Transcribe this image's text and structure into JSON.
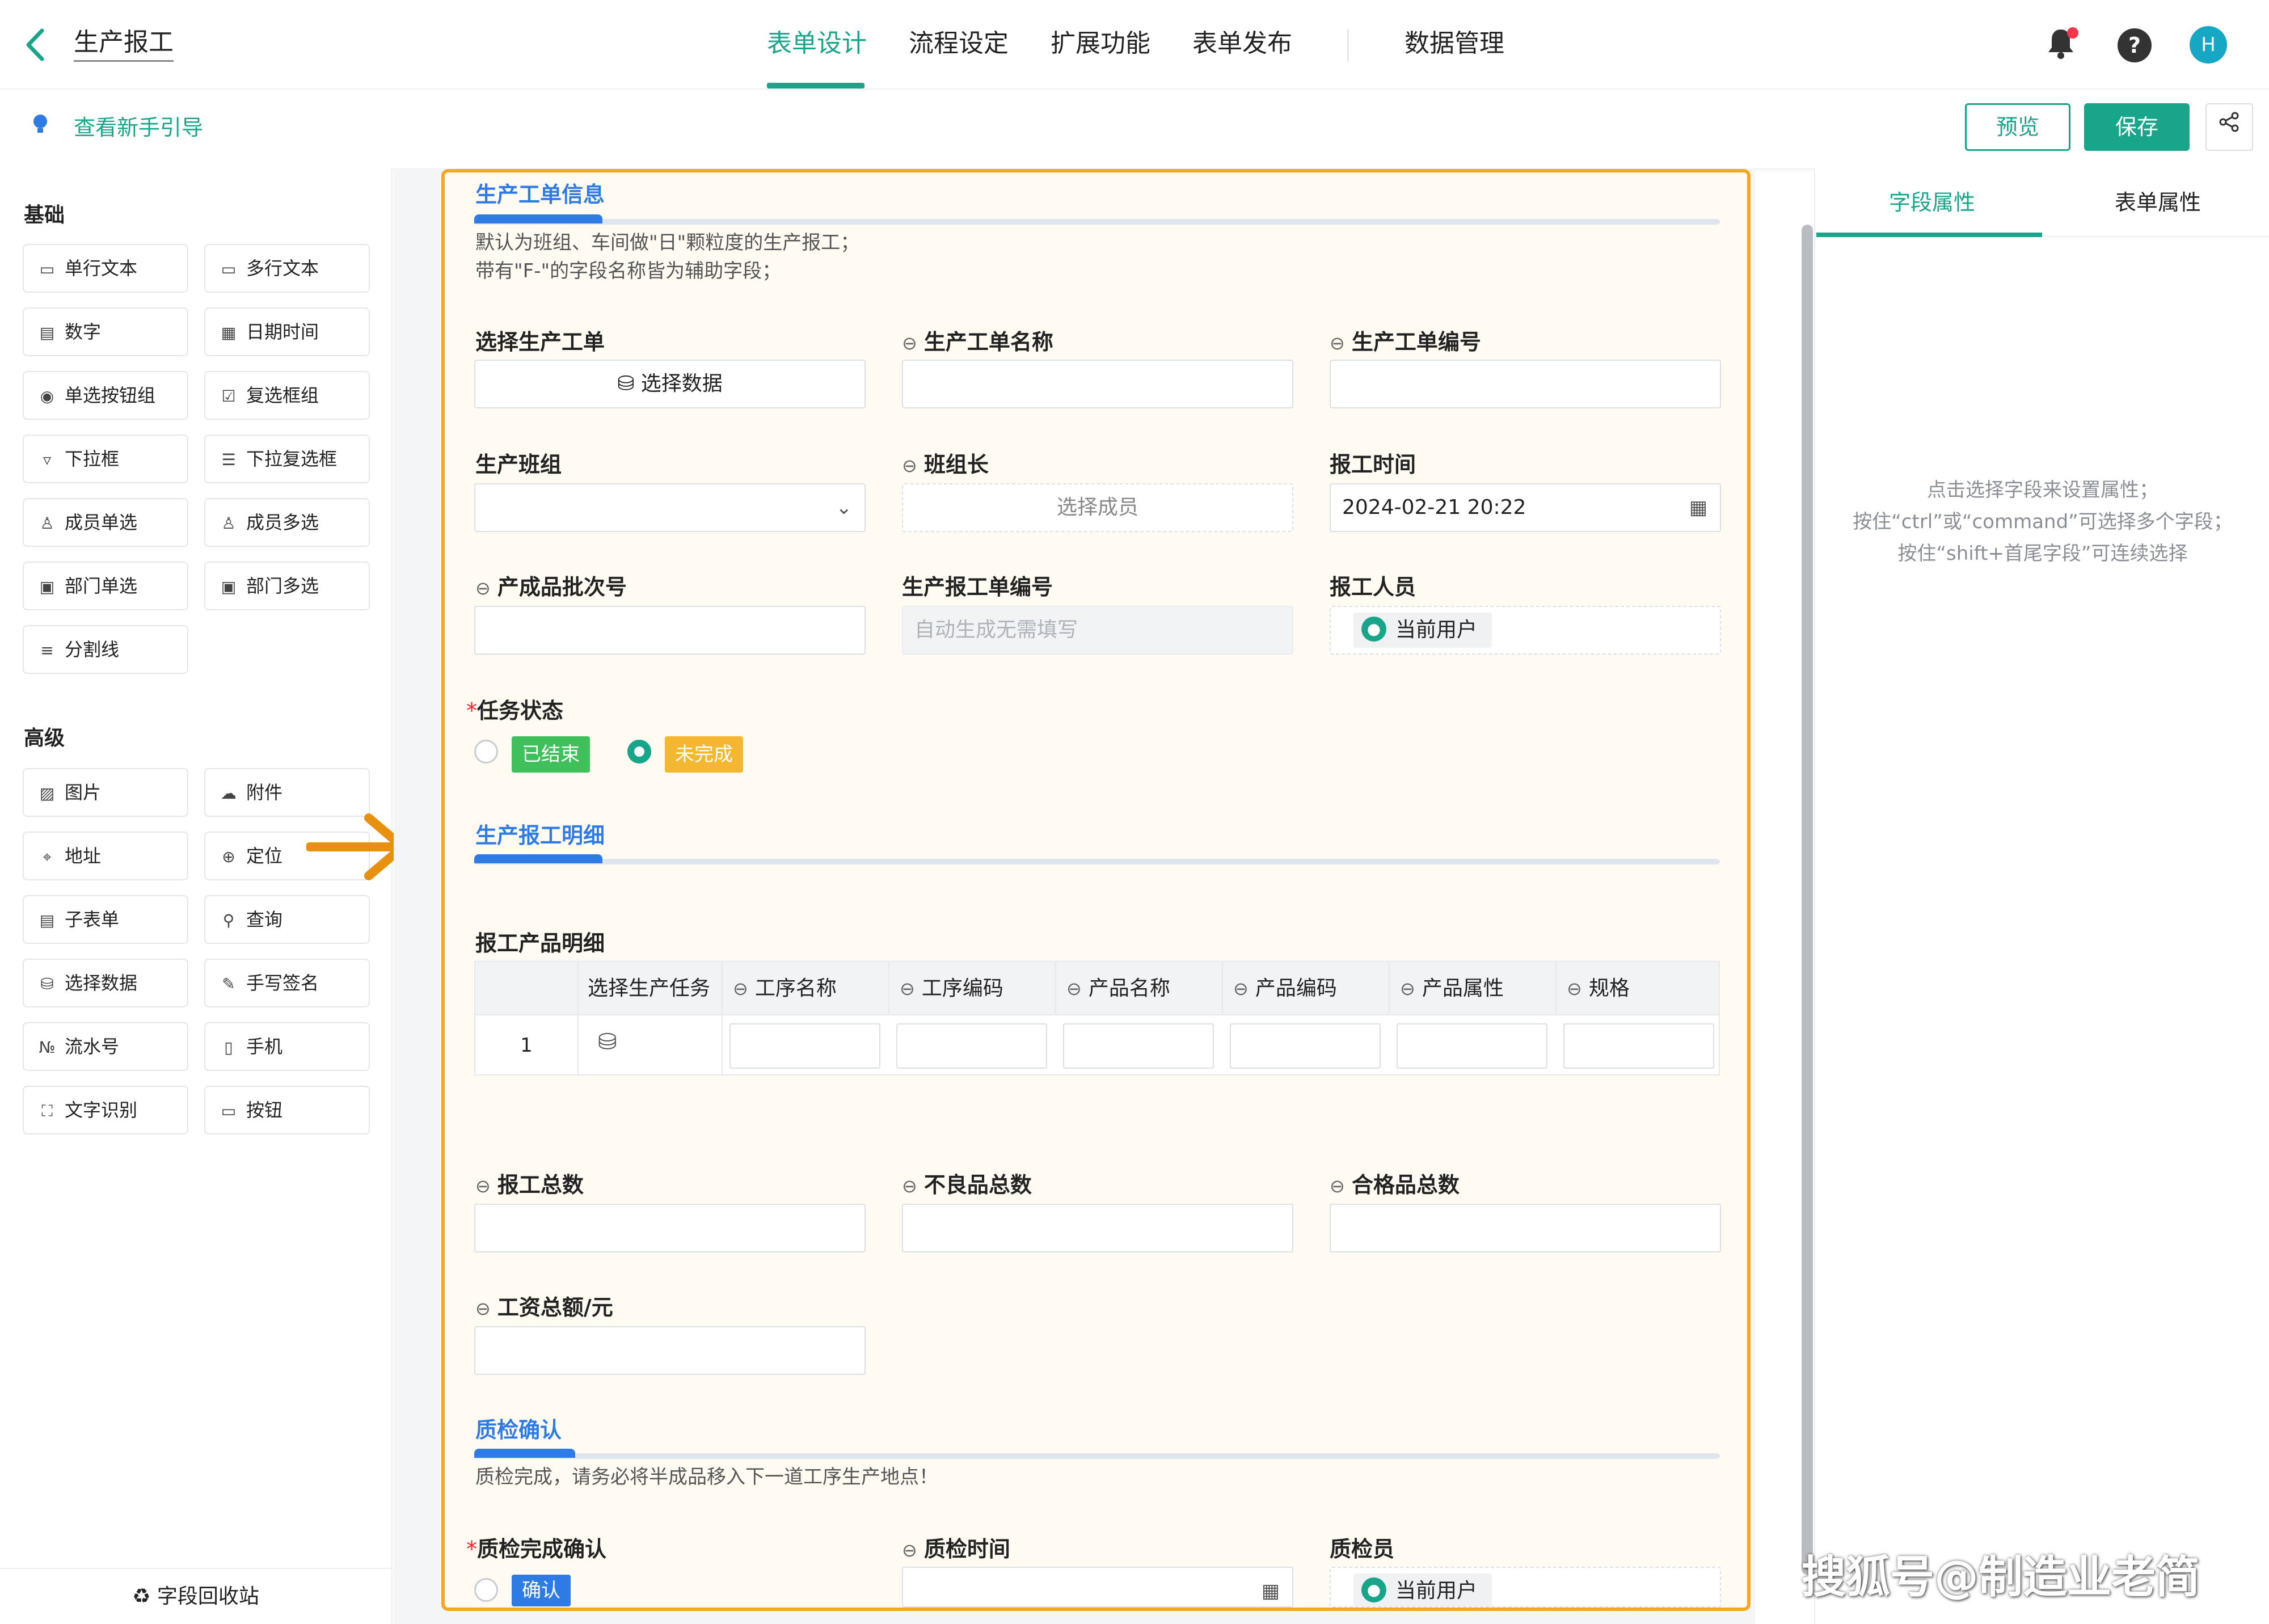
{
  "header": {
    "back_icon": "chevron-left-icon",
    "title": "生产报工",
    "tabs": [
      "表单设计",
      "流程设定",
      "扩展功能",
      "表单发布",
      "数据管理"
    ],
    "active_tab": "表单设计",
    "avatar_initial": "H",
    "accent_color": "#18a58a"
  },
  "subbar": {
    "guide_link": "查看新手引导",
    "preview_label": "预览",
    "save_label": "保存"
  },
  "left_panel": {
    "basic_title": "基础",
    "basic_items": [
      "单行文本",
      "多行文本",
      "数字",
      "日期时间",
      "单选按钮组",
      "复选框组",
      "下拉框",
      "下拉复选框",
      "成员单选",
      "成员多选",
      "部门单选",
      "部门多选",
      "分割线"
    ],
    "advanced_title": "高级",
    "advanced_items": [
      "图片",
      "附件",
      "地址",
      "定位",
      "子表单",
      "查询",
      "选择数据",
      "手写签名",
      "流水号",
      "手机",
      "文字识别",
      "按钮"
    ],
    "recycle_label": "字段回收站"
  },
  "form": {
    "section1": {
      "title": "生产工单信息",
      "desc_line1": "默认为班组、车间做\"日\"颗粒度的生产报工；",
      "desc_line2": "带有\"F-\"的字段名称皆为辅助字段；"
    },
    "fields": {
      "select_order_label": "选择生产工单",
      "select_order_button": "选择数据",
      "order_name_label": "生产工单名称",
      "order_no_label": "生产工单编号",
      "team_label": "生产班组",
      "leader_label": "班组长",
      "leader_placeholder": "选择成员",
      "report_time_label": "报工时间",
      "report_time_value": "2024-02-21 20:22",
      "batch_label": "产成品批次号",
      "report_no_label": "生产报工单编号",
      "report_no_placeholder": "自动生成无需填写",
      "reporter_label": "报工人员",
      "current_user": "当前用户",
      "task_status_label": "任务状态",
      "status_done": "已结束",
      "status_undone": "未完成"
    },
    "section2": {
      "title": "生产报工明细",
      "subtable_label": "报工产品明细",
      "columns": [
        "选择生产任务",
        "工序名称",
        "工序编码",
        "产品名称",
        "产品编码",
        "产品属性",
        "规格"
      ],
      "row_number": "1",
      "total_label": "报工总数",
      "defect_label": "不良品总数",
      "pass_label": "合格品总数",
      "wage_label": "工资总额/元"
    },
    "section3": {
      "title": "质检确认",
      "desc": "质检完成，请务必将半成品移入下一道工序生产地点！",
      "confirm_label": "质检完成确认",
      "confirm_tag": "确认",
      "qc_time_label": "质检时间",
      "inspector_label": "质检员",
      "inspector_value": "当前用户"
    }
  },
  "right_panel": {
    "tab_field": "字段属性",
    "tab_form": "表单属性",
    "hint_line1": "点击选择字段来设置属性；",
    "hint_line2": "按住“ctrl”或“command”可选择多个字段；",
    "hint_line3": "按住“shift+首尾字段”可连续选择"
  },
  "watermark": "搜狐号@制造业老简"
}
